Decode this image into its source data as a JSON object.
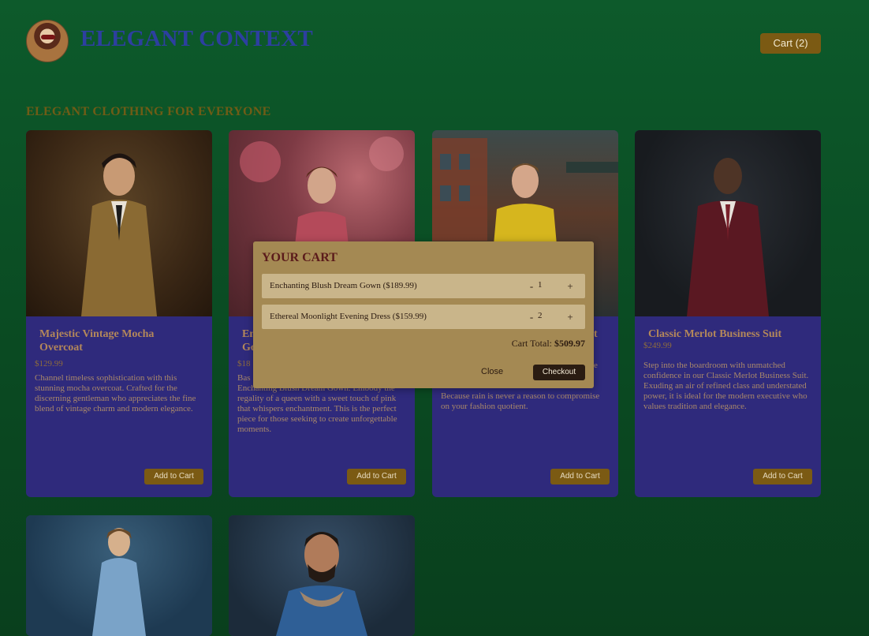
{
  "brand": {
    "name": "ELEGANT CONTEXT"
  },
  "header": {
    "cart_label": "Cart (2)"
  },
  "subtitle": "ELEGANT CLOTHING FOR EVERYONE",
  "products": [
    {
      "name": "Majestic Vintage Mocha Overcoat",
      "price": "$129.99",
      "description": "Channel timeless sophistication with this stunning mocha overcoat. Crafted for the discerning gentleman who appreciates the fine blend of vintage charm and modern elegance.",
      "add_label": "Add to Cart"
    },
    {
      "name": "En",
      "name_line2": "Go",
      "price": "$18",
      "description_prefix": "Bas",
      "description": "Enchanting Blush Dream Gown. Embody the regality of a queen with a sweet touch of pink that whispers enchantment. This is the perfect piece for those seeking to create unforgettable moments.",
      "add_label": "Add to Cart"
    },
    {
      "name": "t",
      "description": "e",
      "description_tail": "Because rain is never a reason to compromise on your fashion quotient.",
      "add_label": "Add to Cart"
    },
    {
      "name": "Classic Merlot Business Suit",
      "price": "$249.99",
      "description": "Step into the boardroom with unmatched confidence in our Classic Merlot Business Suit. Exuding an air of refined class and understated power, it is ideal for the modern executive who values tradition and elegance.",
      "add_label": "Add to Cart"
    }
  ],
  "cart_modal": {
    "title": "YOUR CART",
    "items": [
      {
        "label": "Enchanting Blush Dream Gown ($189.99)",
        "minus": "-",
        "qty": "1",
        "plus": "+"
      },
      {
        "label": "Ethereal Moonlight Evening Dress ($159.99)",
        "minus": "-",
        "qty": "2",
        "plus": "+"
      }
    ],
    "total_label": "Cart Total:",
    "total_value": "$509.97",
    "close_label": "Close",
    "checkout_label": "Checkout"
  }
}
